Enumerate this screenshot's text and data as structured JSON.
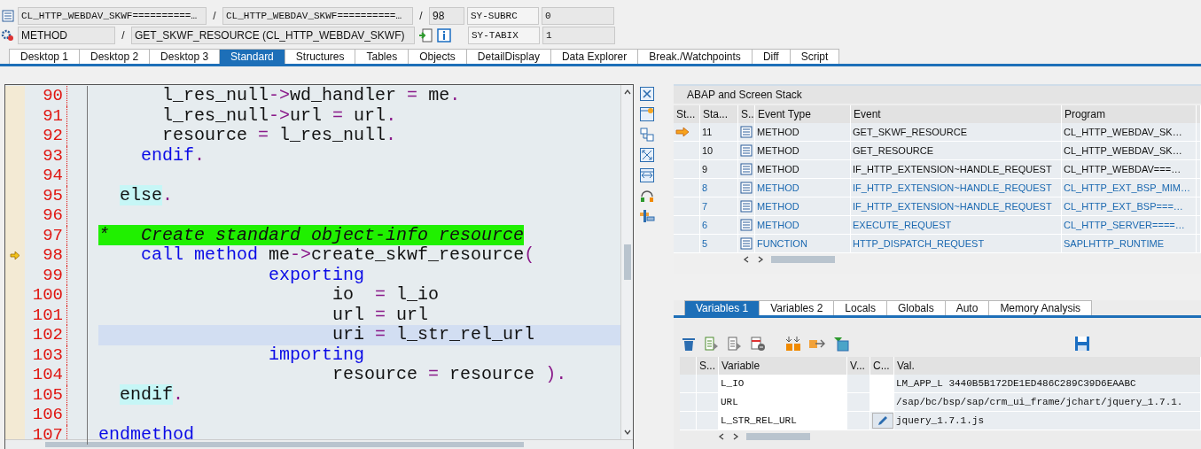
{
  "header": {
    "include": "CL_HTTP_WEBDAV_SKWF==========…",
    "program": "CL_HTTP_WEBDAV_SKWF==========…",
    "separators": [
      "/",
      "/",
      "/"
    ],
    "line": "98",
    "event_type": "METHOD",
    "event": "GET_SKWF_RESOURCE (CL_HTTP_WEBDAV_SKWF)",
    "system_fields": [
      {
        "name": "SY-SUBRC",
        "value": "0"
      },
      {
        "name": "SY-TABIX",
        "value": "1"
      }
    ]
  },
  "tabs": [
    {
      "label": "Desktop 1",
      "selected": false
    },
    {
      "label": "Desktop 2",
      "selected": false
    },
    {
      "label": "Desktop 3",
      "selected": false
    },
    {
      "label": "Standard",
      "selected": true
    },
    {
      "label": "Structures",
      "selected": false
    },
    {
      "label": "Tables",
      "selected": false
    },
    {
      "label": "Objects",
      "selected": false
    },
    {
      "label": "DetailDisplay",
      "selected": false
    },
    {
      "label": "Data Explorer",
      "selected": false
    },
    {
      "label": "Break./Watchpoints",
      "selected": false
    },
    {
      "label": "Diff",
      "selected": false
    },
    {
      "label": "Script",
      "selected": false
    }
  ],
  "code": {
    "lines": [
      {
        "number": "90",
        "current": false,
        "highlighted": false,
        "tokens": [
          {
            "kind": "text",
            "text": "      l_res_null"
          },
          {
            "kind": "op",
            "text": "->"
          },
          {
            "kind": "text",
            "text": "wd_handler "
          },
          {
            "kind": "op",
            "text": "="
          },
          {
            "kind": "text",
            "text": " me"
          },
          {
            "kind": "op",
            "text": "."
          }
        ]
      },
      {
        "number": "91",
        "current": false,
        "highlighted": false,
        "tokens": [
          {
            "kind": "text",
            "text": "      l_res_null"
          },
          {
            "kind": "op",
            "text": "->"
          },
          {
            "kind": "text",
            "text": "url "
          },
          {
            "kind": "op",
            "text": "="
          },
          {
            "kind": "text",
            "text": " url"
          },
          {
            "kind": "op",
            "text": "."
          }
        ]
      },
      {
        "number": "92",
        "current": false,
        "highlighted": false,
        "tokens": [
          {
            "kind": "text",
            "text": "      resource "
          },
          {
            "kind": "op",
            "text": "="
          },
          {
            "kind": "text",
            "text": " l_res_null"
          },
          {
            "kind": "op",
            "text": "."
          }
        ]
      },
      {
        "number": "93",
        "current": false,
        "highlighted": false,
        "tokens": [
          {
            "kind": "keyword",
            "text": "    endif"
          },
          {
            "kind": "op",
            "text": "."
          }
        ]
      },
      {
        "number": "94",
        "current": false,
        "highlighted": false
      },
      {
        "number": "95",
        "current": false,
        "highlighted": false,
        "tokens": [
          {
            "kind": "mark",
            "text": "  else"
          },
          {
            "kind": "op",
            "text": "."
          }
        ]
      },
      {
        "number": "96",
        "current": false,
        "highlighted": false
      },
      {
        "number": "97",
        "current": false,
        "highlighted": false,
        "tokens": [
          {
            "kind": "comment",
            "text": "*   Create standard object-info resource"
          }
        ]
      },
      {
        "number": "98",
        "current": true,
        "highlighted": false,
        "tokens": [
          {
            "kind": "keyword",
            "text": "    call method"
          },
          {
            "kind": "text",
            "text": " me"
          },
          {
            "kind": "op",
            "text": "->"
          },
          {
            "kind": "text",
            "text": "create_skwf_resource"
          },
          {
            "kind": "op",
            "text": "("
          }
        ]
      },
      {
        "number": "99",
        "current": false,
        "highlighted": false,
        "tokens": [
          {
            "kind": "keyword",
            "text": "                exporting"
          }
        ]
      },
      {
        "number": "100",
        "current": false,
        "highlighted": false,
        "tokens": [
          {
            "kind": "text",
            "text": "                      io  "
          },
          {
            "kind": "op",
            "text": "="
          },
          {
            "kind": "text",
            "text": " l_io"
          }
        ]
      },
      {
        "number": "101",
        "current": false,
        "highlighted": false,
        "tokens": [
          {
            "kind": "text",
            "text": "                      url "
          },
          {
            "kind": "op",
            "text": "="
          },
          {
            "kind": "text",
            "text": " url"
          }
        ]
      },
      {
        "number": "102",
        "current": false,
        "highlighted": true,
        "tokens": [
          {
            "kind": "text",
            "text": "                      uri "
          },
          {
            "kind": "op",
            "text": "="
          },
          {
            "kind": "text",
            "text": " l_str_rel_url"
          }
        ]
      },
      {
        "number": "103",
        "current": false,
        "highlighted": false,
        "tokens": [
          {
            "kind": "keyword",
            "text": "                importing"
          }
        ]
      },
      {
        "number": "104",
        "current": false,
        "highlighted": false,
        "tokens": [
          {
            "kind": "text",
            "text": "                      resource "
          },
          {
            "kind": "op",
            "text": "="
          },
          {
            "kind": "text",
            "text": " resource "
          },
          {
            "kind": "op",
            "text": ")"
          },
          {
            "kind": "op",
            "text": "."
          }
        ]
      },
      {
        "number": "105",
        "current": false,
        "highlighted": false,
        "tokens": [
          {
            "kind": "mark",
            "text": "  endif"
          },
          {
            "kind": "op",
            "text": "."
          }
        ]
      },
      {
        "number": "106",
        "current": false,
        "highlighted": false
      },
      {
        "number": "107",
        "current": false,
        "highlighted": false,
        "tokens": [
          {
            "kind": "keyword",
            "text": "endmethod"
          }
        ]
      }
    ]
  },
  "stack": {
    "title": "ABAP and Screen Stack",
    "columns": [
      "St...",
      "Sta...",
      "S..",
      "Event Type",
      "Event",
      "Program"
    ],
    "rows": [
      {
        "current": true,
        "linked": false,
        "level": "11",
        "event_type": "METHOD",
        "event": "GET_SKWF_RESOURCE",
        "program": "CL_HTTP_WEBDAV_SK…"
      },
      {
        "current": false,
        "linked": false,
        "level": "10",
        "event_type": "METHOD",
        "event": "GET_RESOURCE",
        "program": "CL_HTTP_WEBDAV_SK…"
      },
      {
        "current": false,
        "linked": false,
        "level": "9",
        "event_type": "METHOD",
        "event": "IF_HTTP_EXTENSION~HANDLE_REQUEST",
        "program": "CL_HTTP_WEBDAV===…"
      },
      {
        "current": false,
        "linked": true,
        "level": "8",
        "event_type": "METHOD",
        "event": "IF_HTTP_EXTENSION~HANDLE_REQUEST",
        "program": "CL_HTTP_EXT_BSP_MIM…"
      },
      {
        "current": false,
        "linked": true,
        "level": "7",
        "event_type": "METHOD",
        "event": "IF_HTTP_EXTENSION~HANDLE_REQUEST",
        "program": "CL_HTTP_EXT_BSP===…"
      },
      {
        "current": false,
        "linked": true,
        "level": "6",
        "event_type": "METHOD",
        "event": "EXECUTE_REQUEST",
        "program": "CL_HTTP_SERVER====…"
      },
      {
        "current": false,
        "linked": true,
        "level": "5",
        "event_type": "FUNCTION",
        "event": "HTTP_DISPATCH_REQUEST",
        "program": "SAPLHTTP_RUNTIME"
      }
    ]
  },
  "variables": {
    "tabs": [
      {
        "label": "Variables 1",
        "selected": true
      },
      {
        "label": "Variables 2",
        "selected": false
      },
      {
        "label": "Locals",
        "selected": false
      },
      {
        "label": "Globals",
        "selected": false
      },
      {
        "label": "Auto",
        "selected": false
      },
      {
        "label": "Memory Analysis",
        "selected": false
      }
    ],
    "columns": [
      "S...",
      "Variable",
      "V...",
      "C...",
      "Val."
    ],
    "rows": [
      {
        "name": "L_IO",
        "editable": false,
        "value": "LM_APP_L   3440B5B172DE1ED486C289C39D6EAABC"
      },
      {
        "name": "URL",
        "editable": false,
        "value": "/sap/bc/bsp/sap/crm_ui_frame/jchart/jquery_1.7.1."
      },
      {
        "name": "L_STR_REL_URL",
        "editable": true,
        "value": "jquery_1.7.1.js"
      }
    ]
  }
}
